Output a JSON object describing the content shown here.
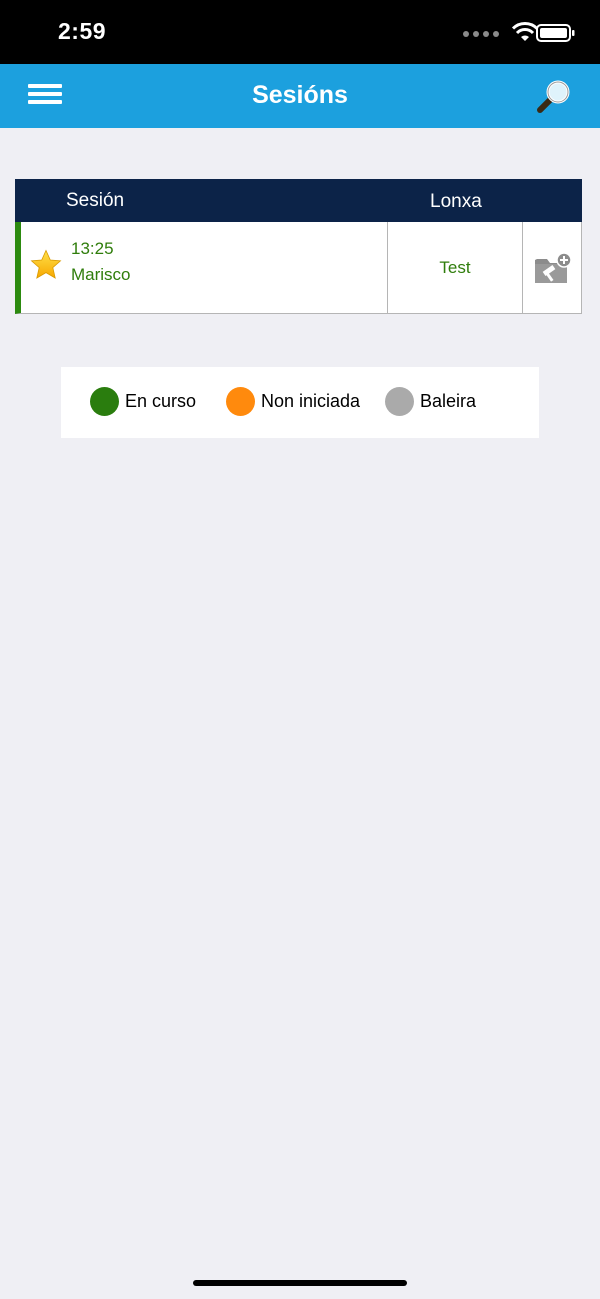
{
  "status_bar": {
    "time": "2:59",
    "icons": [
      "signal-dots-icon",
      "wifi-icon",
      "battery-icon"
    ]
  },
  "nav": {
    "title": "Sesións",
    "left_icon": "menu-icon",
    "right_icon": "search-icon",
    "background": "#1ca0de"
  },
  "table": {
    "headers": {
      "session": "Sesión",
      "lonxa": "Lonxa"
    },
    "header_background": "#0c2348",
    "rows": [
      {
        "favorite_icon": "star-icon",
        "time": "13:25",
        "name": "Marisco",
        "lonxa": "Test",
        "action_icon": "folder-add-icon",
        "status_color": "#2c8a0f"
      }
    ]
  },
  "legend": {
    "items": [
      {
        "label": "En curso",
        "color": "#2a7d0e"
      },
      {
        "label": "Non iniciada",
        "color": "#ff8a0d"
      },
      {
        "label": "Baleira",
        "color": "#aaaaaa"
      }
    ]
  }
}
